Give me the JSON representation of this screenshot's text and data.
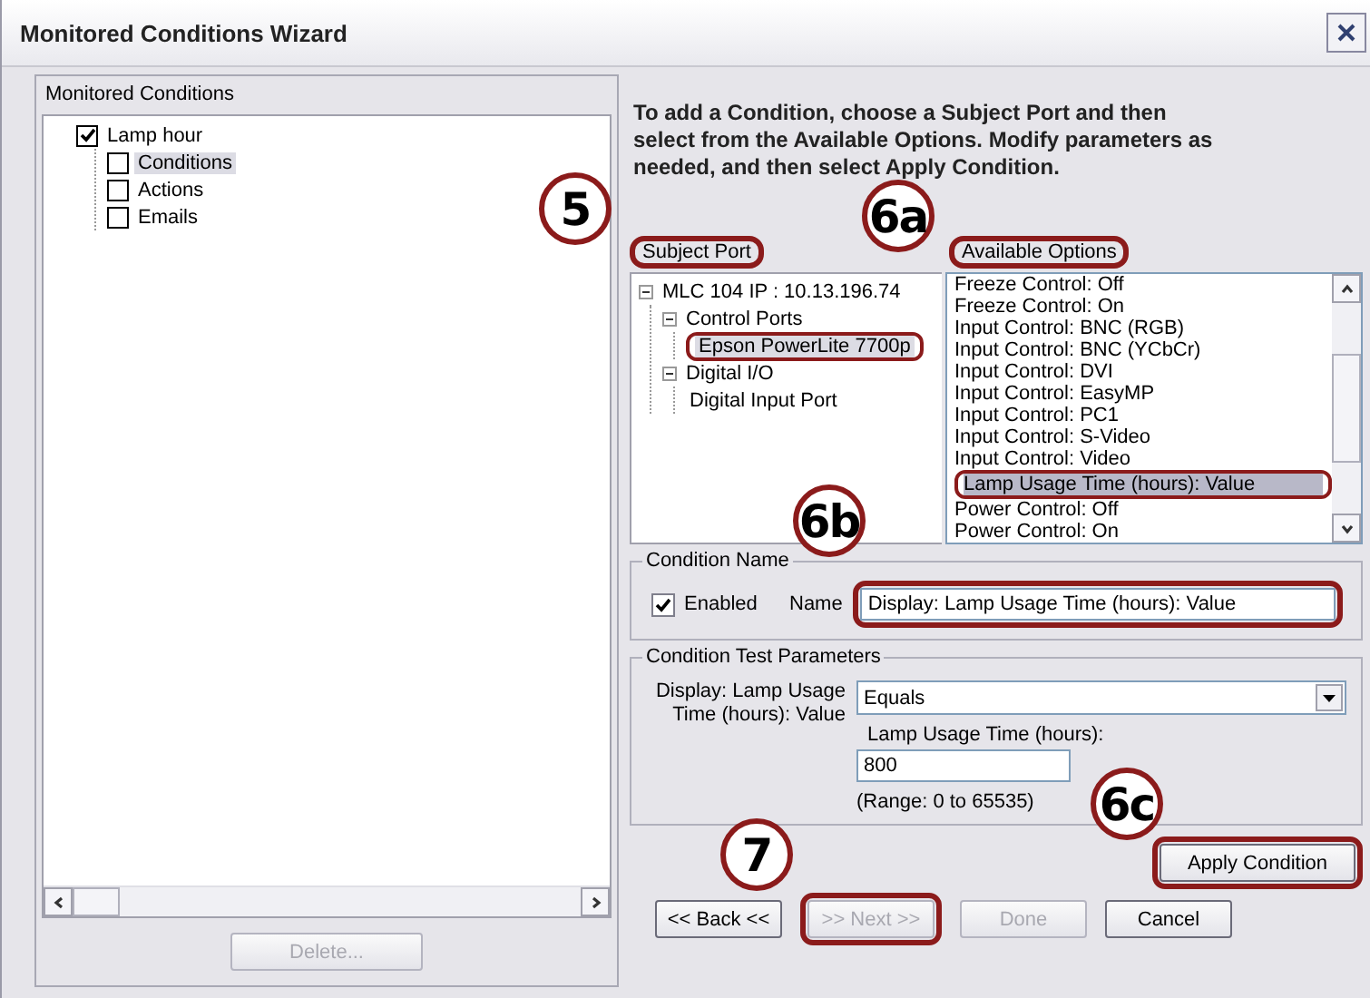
{
  "window": {
    "title": "Monitored Conditions Wizard"
  },
  "left_panel": {
    "label": "Monitored Conditions",
    "tree": [
      {
        "label": "Lamp hour",
        "checked": true,
        "selected": false,
        "children": [
          {
            "label": "Conditions",
            "checked": false,
            "selected": true
          },
          {
            "label": "Actions",
            "checked": false,
            "selected": false
          },
          {
            "label": "Emails",
            "checked": false,
            "selected": false
          }
        ]
      }
    ],
    "delete_button": {
      "label": "Delete...",
      "disabled": true
    }
  },
  "instructions": "To add a Condition, choose a Subject Port and then select from the Available Options. Modify parameters as needed, and then select Apply Condition.",
  "subject_port": {
    "label": "Subject Port",
    "highlighted": true,
    "tree": [
      {
        "label": "MLC 104 IP : 10.13.196.74",
        "selected": false,
        "highlighted": false,
        "children": [
          {
            "label": "Control Ports",
            "selected": false,
            "highlighted": false,
            "children": [
              {
                "label": "Epson PowerLite 7700p",
                "selected": true,
                "highlighted": true
              }
            ]
          },
          {
            "label": "Digital I/O",
            "selected": false,
            "highlighted": false,
            "children": [
              {
                "label": "Digital Input Port",
                "selected": false,
                "highlighted": false
              }
            ]
          }
        ]
      }
    ]
  },
  "available_options": {
    "label": "Available Options",
    "highlighted": true,
    "items": [
      {
        "label": "Freeze Control: Off",
        "selected": false,
        "highlighted": false
      },
      {
        "label": "Freeze Control: On",
        "selected": false,
        "highlighted": false
      },
      {
        "label": "Input Control: BNC (RGB)",
        "selected": false,
        "highlighted": false
      },
      {
        "label": "Input Control: BNC (YCbCr)",
        "selected": false,
        "highlighted": false
      },
      {
        "label": "Input Control: DVI",
        "selected": false,
        "highlighted": false
      },
      {
        "label": "Input Control: EasyMP",
        "selected": false,
        "highlighted": false
      },
      {
        "label": "Input Control: PC1",
        "selected": false,
        "highlighted": false
      },
      {
        "label": "Input Control: S-Video",
        "selected": false,
        "highlighted": false
      },
      {
        "label": "Input Control: Video",
        "selected": false,
        "highlighted": false
      },
      {
        "label": "Lamp Usage Time (hours): Value",
        "selected": true,
        "highlighted": true
      },
      {
        "label": "Power Control: Off",
        "selected": false,
        "highlighted": false
      },
      {
        "label": "Power Control: On",
        "selected": false,
        "highlighted": false
      }
    ]
  },
  "condition_name": {
    "legend": "Condition Name",
    "enabled_label": "Enabled",
    "enabled": true,
    "name_label": "Name",
    "name_value": "Display: Lamp Usage Time (hours): Value",
    "highlighted": true
  },
  "test_parameters": {
    "legend": "Condition Test Parameters",
    "parameter_label": "Display: Lamp Usage Time (hours): Value",
    "operator": "Equals",
    "value_label": "Lamp Usage Time (hours):",
    "value": "800",
    "range": "(Range: 0 to 65535)"
  },
  "apply_button": {
    "label": "Apply Condition",
    "highlighted": true
  },
  "nav_buttons": [
    {
      "label": "<< Back <<",
      "disabled": false,
      "highlighted": false
    },
    {
      "label": ">> Next >>",
      "disabled": true,
      "highlighted": true
    },
    {
      "label": "Done",
      "disabled": true,
      "highlighted": false
    },
    {
      "label": "Cancel",
      "disabled": false,
      "highlighted": false
    }
  ],
  "callouts": [
    {
      "label": "5"
    },
    {
      "label": "6a"
    },
    {
      "label": "6b"
    },
    {
      "label": "6c"
    },
    {
      "label": "7"
    }
  ]
}
